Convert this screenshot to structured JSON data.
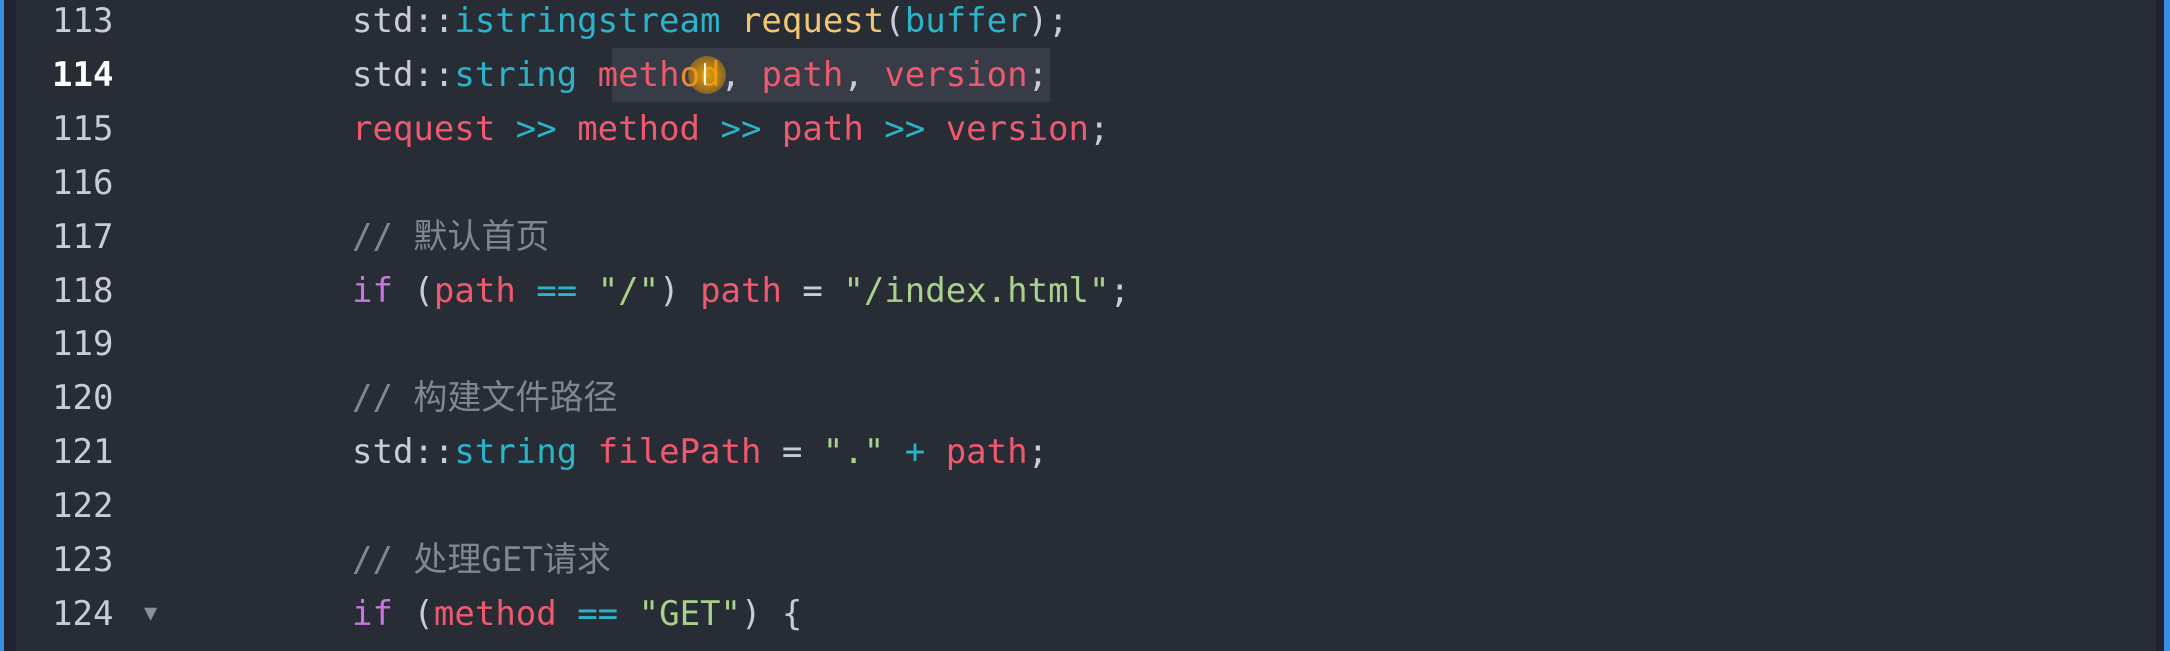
{
  "editor": {
    "active_line": "114",
    "lines": [
      {
        "number": "113",
        "tokens": [
          {
            "text": "std::",
            "kind": "plain"
          },
          {
            "text": "istringstream",
            "kind": "type"
          },
          {
            "text": " ",
            "kind": "plain"
          },
          {
            "text": "request",
            "kind": "fn"
          },
          {
            "text": "(",
            "kind": "plain"
          },
          {
            "text": "buffer",
            "kind": "type"
          },
          {
            "text": ");",
            "kind": "plain"
          }
        ]
      },
      {
        "number": "114",
        "tokens": [
          {
            "text": "std::",
            "kind": "plain"
          },
          {
            "text": "string",
            "kind": "type"
          },
          {
            "text": " ",
            "kind": "plain"
          },
          {
            "text": "meth",
            "kind": "var"
          },
          {
            "text": "od",
            "kind": "mix"
          },
          {
            "text": ", ",
            "kind": "plain"
          },
          {
            "text": "path",
            "kind": "var"
          },
          {
            "text": ", ",
            "kind": "plain"
          },
          {
            "text": "version",
            "kind": "var"
          },
          {
            "text": ";",
            "kind": "plain"
          }
        ]
      },
      {
        "number": "115",
        "tokens": [
          {
            "text": "request",
            "kind": "var"
          },
          {
            "text": " >> ",
            "kind": "op"
          },
          {
            "text": "method",
            "kind": "var"
          },
          {
            "text": " >> ",
            "kind": "op"
          },
          {
            "text": "path",
            "kind": "var"
          },
          {
            "text": " >> ",
            "kind": "op"
          },
          {
            "text": "version",
            "kind": "var"
          },
          {
            "text": ";",
            "kind": "plain"
          }
        ]
      },
      {
        "number": "116",
        "tokens": []
      },
      {
        "number": "117",
        "tokens": [
          {
            "text": "// 默认首页",
            "kind": "cmt"
          }
        ]
      },
      {
        "number": "118",
        "tokens": [
          {
            "text": "if",
            "kind": "kw"
          },
          {
            "text": " (",
            "kind": "plain"
          },
          {
            "text": "path",
            "kind": "var"
          },
          {
            "text": " == ",
            "kind": "op"
          },
          {
            "text": "\"/\"",
            "kind": "str"
          },
          {
            "text": ") ",
            "kind": "plain"
          },
          {
            "text": "path",
            "kind": "var"
          },
          {
            "text": " = ",
            "kind": "plain"
          },
          {
            "text": "\"/index.html\"",
            "kind": "str"
          },
          {
            "text": ";",
            "kind": "plain"
          }
        ]
      },
      {
        "number": "119",
        "tokens": []
      },
      {
        "number": "120",
        "tokens": [
          {
            "text": "// 构建文件路径",
            "kind": "cmt"
          }
        ]
      },
      {
        "number": "121",
        "tokens": [
          {
            "text": "std::",
            "kind": "plain"
          },
          {
            "text": "string",
            "kind": "type"
          },
          {
            "text": " ",
            "kind": "plain"
          },
          {
            "text": "filePath",
            "kind": "var"
          },
          {
            "text": " = ",
            "kind": "plain"
          },
          {
            "text": "\".\"",
            "kind": "str"
          },
          {
            "text": " + ",
            "kind": "op"
          },
          {
            "text": "path",
            "kind": "var"
          },
          {
            "text": ";",
            "kind": "plain"
          }
        ]
      },
      {
        "number": "122",
        "tokens": []
      },
      {
        "number": "123",
        "tokens": [
          {
            "text": "// 处理GET请求",
            "kind": "cmt"
          }
        ]
      },
      {
        "number": "124",
        "fold": true,
        "tokens": [
          {
            "text": "if",
            "kind": "kw"
          },
          {
            "text": " (",
            "kind": "plain"
          },
          {
            "text": "method",
            "kind": "var"
          },
          {
            "text": " == ",
            "kind": "op"
          },
          {
            "text": "\"GET\"",
            "kind": "str"
          },
          {
            "text": ") {",
            "kind": "plain"
          }
        ]
      }
    ]
  },
  "icons": {
    "fold": "chevron-down-icon",
    "cursor": "text-cursor-icon"
  },
  "colors": {
    "background": "#282c34",
    "frame": "#3a8de0",
    "type": "#2bb3c9",
    "function": "#f0c674",
    "variable": "#ef596f",
    "keyword": "#c678dd",
    "string": "#a9d18e",
    "comment": "#7f8794"
  }
}
